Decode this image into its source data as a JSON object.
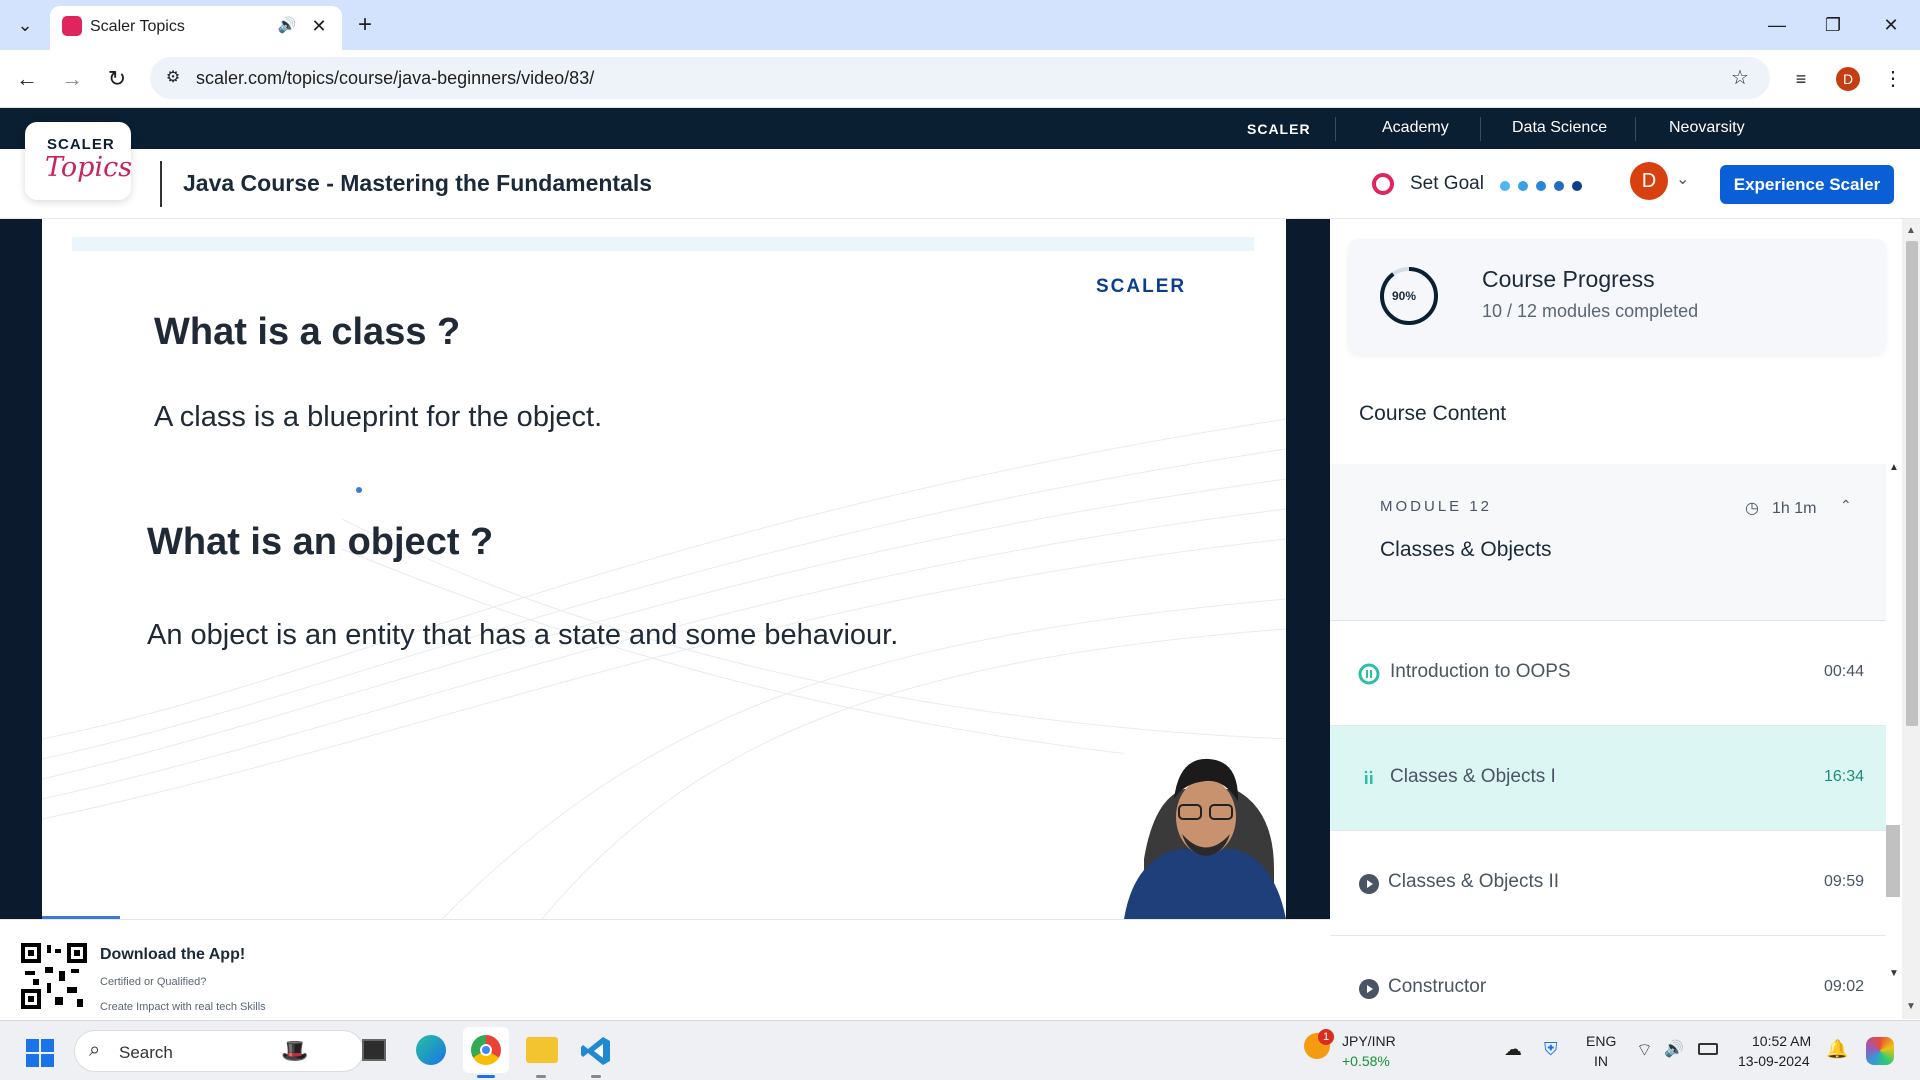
{
  "browser": {
    "tab_title": "Scaler Topics",
    "url": "scaler.com/topics/course/java-beginners/video/83/",
    "profile_initial": "D"
  },
  "site_nav": {
    "brand": "SCALER",
    "links": [
      "Academy",
      "Data Science",
      "Neovarsity"
    ]
  },
  "header": {
    "logo_top": "SCALER",
    "logo_bottom": "Topics",
    "course_title": "Java Course - Mastering the Fundamentals",
    "set_goal": "Set Goal",
    "avatar_initial": "D",
    "cta": "Experience Scaler"
  },
  "slide": {
    "brand": "SCALER",
    "q1": "What is a class ?",
    "a1": "A class is a blueprint for the object.",
    "q2": "What is an object ?",
    "a2": "An object is an entity that has a state and some behaviour."
  },
  "progress": {
    "percent_label": "90%",
    "percent": 90,
    "title": "Course Progress",
    "subtitle": "10 / 12 modules completed"
  },
  "course_content": {
    "heading": "Course Content",
    "module_label": "MODULE 12",
    "module_duration": "1h 1m",
    "module_title": "Classes & Objects",
    "lessons": [
      {
        "title": "Introduction to OOPS",
        "time": "00:44",
        "state": "completed"
      },
      {
        "title": "Classes & Objects I",
        "time": "16:34",
        "state": "playing"
      },
      {
        "title": "Classes & Objects II",
        "time": "09:59",
        "state": "pending"
      },
      {
        "title": "Constructor",
        "time": "09:02",
        "state": "pending"
      }
    ]
  },
  "app_banner": {
    "title": "Download the App!",
    "line1": "Certified or Qualified?",
    "line2": "Create Impact with real tech Skills"
  },
  "taskbar": {
    "search": "Search",
    "ticker_name": "JPY/INR",
    "ticker_change": "+0.58%",
    "ticker_badge": "1",
    "lang_top": "ENG",
    "lang_bottom": "IN",
    "time": "10:52 AM",
    "date": "13-09-2024"
  },
  "colors": {
    "brand_dark": "#0b1f33",
    "cta_blue": "#0b5fd6",
    "playing_row": "#dcf7f3",
    "progress_ring": "#0b1f33"
  }
}
